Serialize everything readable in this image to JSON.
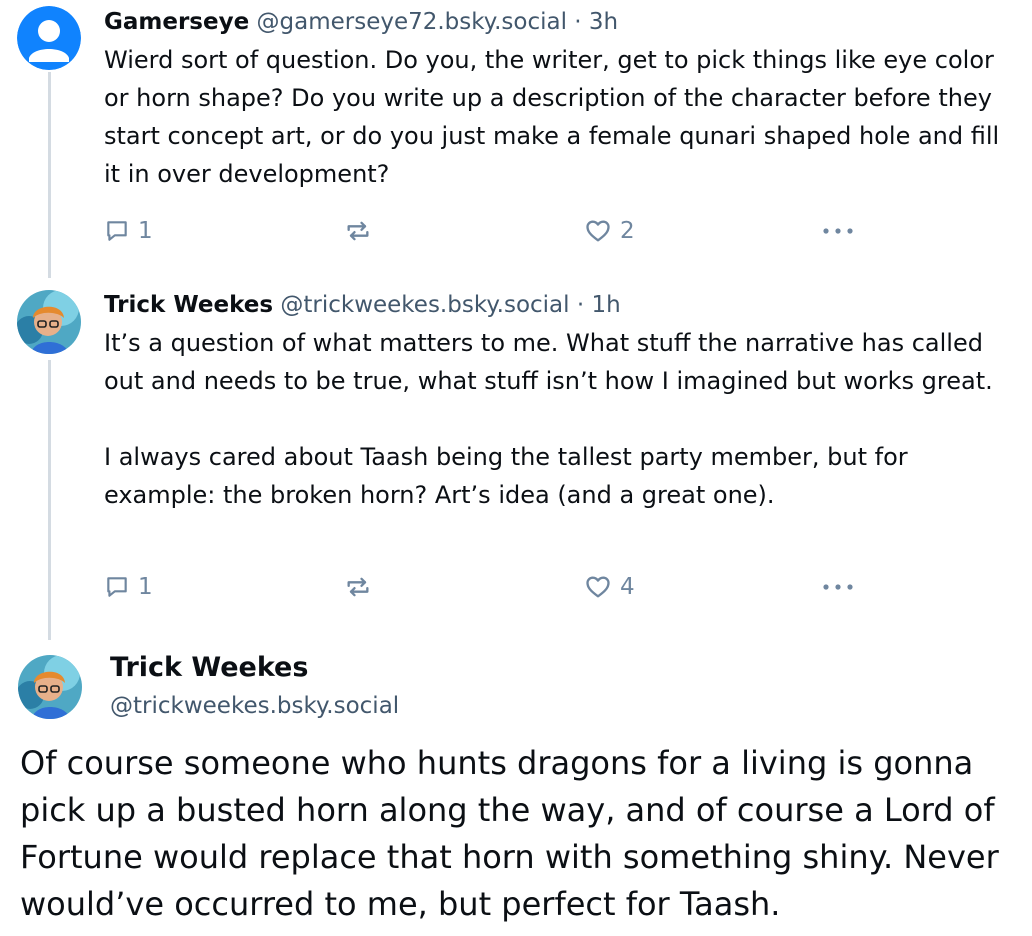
{
  "colors": {
    "text": "#0b0f14",
    "muted": "#42576c",
    "icon": "#6f869f",
    "thread_line": "#d4dbe2",
    "default_avatar": "#1083fe"
  },
  "posts": [
    {
      "author": "Gamerseye",
      "handle": "@gamerseye72.bsky.social",
      "time": "· 3h",
      "avatar": "default-avatar",
      "paragraphs": [
        "Wierd sort of question. Do you, the writer, get to pick things like eye color or horn shape? Do you write up a description of the character before they start concept art, or do you just make a female qunari shaped hole and fill it in over development?"
      ],
      "replies": "1",
      "reposts": "",
      "likes": "2"
    },
    {
      "author": "Trick Weekes",
      "handle": "@trickweekes.bsky.social",
      "time": "· 1h",
      "avatar": "profile-photo",
      "paragraphs": [
        "It’s a question of what matters to me. What stuff the narrative has called out and needs to be true, what stuff isn’t how I imagined but works great.",
        "I always cared about Taash being the tallest party member, but for example: the broken horn? Art’s idea (and a great one)."
      ],
      "replies": "1",
      "reposts": "",
      "likes": "4"
    }
  ],
  "main_post": {
    "author": "Trick Weekes",
    "handle": "@trickweekes.bsky.social",
    "text": "Of course someone who hunts dragons for a living is gonna pick up a busted horn along the way, and of course a Lord of Fortune would replace that horn with something shiny. Never would’ve occurred to me, but perfect for Taash."
  },
  "icons": {
    "reply": "speech-bubble-icon",
    "repost": "repost-arrows-icon",
    "like": "heart-outline-icon",
    "more": "ellipsis-icon"
  }
}
